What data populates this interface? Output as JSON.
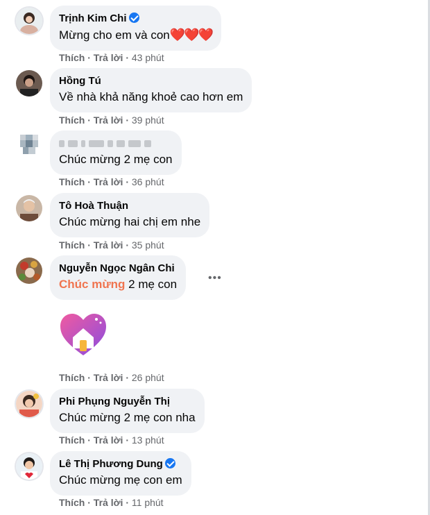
{
  "actions": {
    "like": "Thích",
    "reply": "Trả lời",
    "sep": "·"
  },
  "comments": [
    {
      "name": "Trịnh Kim Chi",
      "verified": true,
      "text": "Mừng cho em và con",
      "emoji": "❤️❤️❤️",
      "time": "43 phút"
    },
    {
      "name": "Hồng Tú",
      "verified": false,
      "text": "Về nhà khả năng khoẻ cao hơn em",
      "time": "39 phút"
    },
    {
      "name": "",
      "verified": false,
      "blurred": true,
      "text": "Chúc mừng 2 mẹ con",
      "time": "36 phút"
    },
    {
      "name": "Tô Hoà Thuận",
      "verified": false,
      "text": "Chúc mừng hai chị em nhe",
      "time": "35 phút"
    },
    {
      "name": "Nguyễn Ngọc Ngân Chi",
      "verified": false,
      "tag": "Chúc mừng",
      "text": " 2 mẹ con",
      "time": "26 phút",
      "sticker": "house-heart-sticker",
      "menu": "•••"
    },
    {
      "name": "Phi Phụng Nguyễn Thị",
      "verified": false,
      "text": "Chúc mừng 2 mẹ con nha",
      "time": "13 phút"
    },
    {
      "name": "Lê Thị Phương Dung",
      "verified": true,
      "text": "Chúc mừng mẹ con em",
      "time": "11 phút"
    }
  ],
  "colors": {
    "bubble": "#f0f2f5",
    "meta": "#65676b",
    "tag": "#f0744f",
    "verified": "#1877f2"
  }
}
